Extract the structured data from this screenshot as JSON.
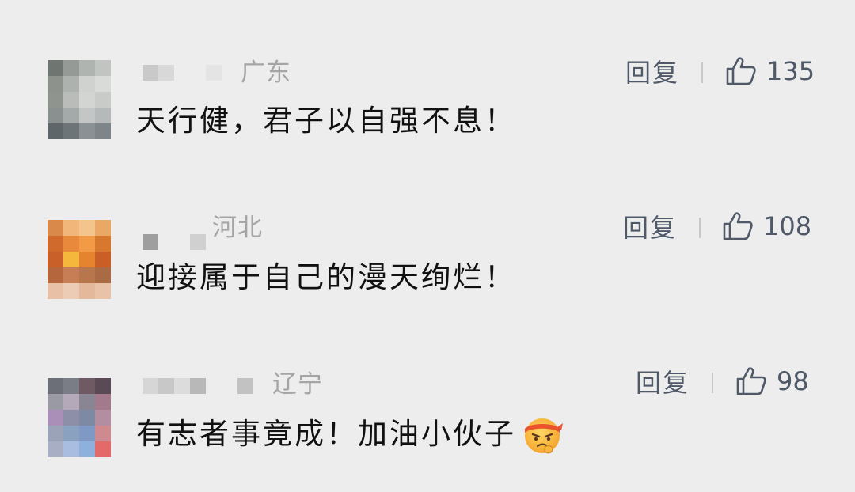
{
  "comments": [
    {
      "region": "广东",
      "text": "天行健，君子以自强不息！",
      "reply_label": "回复",
      "likes": "135",
      "avatar_colors": [
        "#6f7570",
        "#969a96",
        "#b0b4b0",
        "#c2c4c1",
        "#8e928c",
        "#aeb2ae",
        "#cfd2cf",
        "#d9dbd9",
        "#8f948f",
        "#b9bcb9",
        "#d3d5d3",
        "#c8cbc8",
        "#8a8f8f",
        "#a4a9a9",
        "#c3c6c5",
        "#b5b9b9",
        "#5f666a",
        "#6d7478",
        "#8a9093",
        "#7d8589"
      ],
      "name_colors": [
        "#c9c9c9",
        "#d8d8d8",
        "#e4e4e4",
        "#bcbcbc"
      ]
    },
    {
      "region": "河北",
      "text": "迎接属于自己的漫天绚烂！",
      "reply_label": "回复",
      "likes": "108",
      "avatar_colors": [
        "#d98a4b",
        "#f0b67a",
        "#f3c48b",
        "#e9a866",
        "#cf6a2c",
        "#e8893c",
        "#f29a46",
        "#d8782f",
        "#c9602a",
        "#f5b73c",
        "#e5842e",
        "#c95f27",
        "#b5663c",
        "#c87e55",
        "#b8764c",
        "#a96a44",
        "#e7c0a6",
        "#edccb6",
        "#e3b89b",
        "#e9c3a8"
      ],
      "name_colors": [
        "#9e9e9e",
        "#d0d0d0"
      ]
    },
    {
      "region": "辽宁",
      "text": "有志者事竟成！加油小伙子",
      "reply_label": "回复",
      "likes": "98",
      "avatar_colors": [
        "#6c6f78",
        "#7b7d86",
        "#6f5a63",
        "#5a4a55",
        "#9a9aa5",
        "#b4a9b8",
        "#8a8593",
        "#a27a8c",
        "#aa90b8",
        "#8d8fa8",
        "#7e8aa4",
        "#b38ea0",
        "#9aa3b8",
        "#8aa2c0",
        "#7f98c4",
        "#cf8a8f",
        "#a8aec4",
        "#a9bde0",
        "#8eb0dc",
        "#e46a6a"
      ],
      "name_colors": [
        "#d6d6d6",
        "#c8c8c8",
        "#dcdcdc",
        "#b8b8b8",
        "#c2c2c2"
      ]
    }
  ],
  "icons": {
    "like": "thumbs-up-outline",
    "emoji": "determined-face-with-headband"
  }
}
